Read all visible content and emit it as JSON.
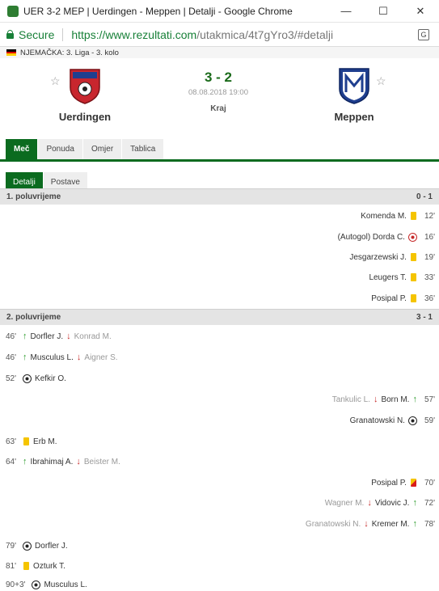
{
  "browser": {
    "tab_title": "UER 3-2 MEP | Uerdingen - Meppen | Detalji - Google Chrome",
    "secure_label": "Secure",
    "url_host": "https://www.rezultati.com",
    "url_path": "/utakmica/4t7gYro3/#detalji",
    "min_glyph": "—",
    "max_glyph": "☐",
    "close_glyph": "✕"
  },
  "league": "NJEMAČKA: 3. Liga - 3. kolo",
  "match": {
    "home": "Uerdingen",
    "away": "Meppen",
    "score": "3 - 2",
    "date": "08.08.2018 19:00",
    "status": "Kraj"
  },
  "tabs": [
    "Meč",
    "Ponuda",
    "Omjer",
    "Tablica"
  ],
  "subtabs": [
    "Detalji",
    "Postave"
  ],
  "halves": [
    {
      "label": "1. poluvrijeme",
      "score": "0 - 1"
    },
    {
      "label": "2. poluvrijeme",
      "score": "3 - 1"
    }
  ],
  "events_first": [
    {
      "side": "right",
      "minute": "12'",
      "type": "yellow",
      "player": "Komenda M."
    },
    {
      "side": "right",
      "minute": "16'",
      "type": "own-goal",
      "player": "(Autogol) Dorda C."
    },
    {
      "side": "right",
      "minute": "19'",
      "type": "yellow",
      "player": "Jesgarzewski J."
    },
    {
      "side": "right",
      "minute": "33'",
      "type": "yellow",
      "player": "Leugers T."
    },
    {
      "side": "right",
      "minute": "36'",
      "type": "yellow",
      "player": "Posipal P."
    }
  ],
  "events_second": [
    {
      "side": "left",
      "minute": "46'",
      "type": "sub",
      "player_in": "Dorfler J.",
      "player_out": "Konrad M."
    },
    {
      "side": "left",
      "minute": "46'",
      "type": "sub",
      "player_in": "Musculus L.",
      "player_out": "Aigner S."
    },
    {
      "side": "left",
      "minute": "52'",
      "type": "goal",
      "player": "Kefkir O."
    },
    {
      "side": "right",
      "minute": "57'",
      "type": "sub",
      "player_in": "Born M.",
      "player_out": "Tankulic L."
    },
    {
      "side": "right",
      "minute": "59'",
      "type": "goal",
      "player": "Granatowski N."
    },
    {
      "side": "left",
      "minute": "63'",
      "type": "yellow",
      "player": "Erb M."
    },
    {
      "side": "left",
      "minute": "64'",
      "type": "sub",
      "player_in": "Ibrahimaj A.",
      "player_out": "Beister M."
    },
    {
      "side": "right",
      "minute": "70'",
      "type": "yellow-red",
      "player": "Posipal P."
    },
    {
      "side": "right",
      "minute": "72'",
      "type": "sub",
      "player_in": "Vidovic J.",
      "player_out": "Wagner M."
    },
    {
      "side": "right",
      "minute": "78'",
      "type": "sub",
      "player_in": "Kremer M.",
      "player_out": "Granatowski N."
    },
    {
      "side": "left",
      "minute": "79'",
      "type": "goal",
      "player": "Dorfler J."
    },
    {
      "side": "left",
      "minute": "81'",
      "type": "yellow",
      "player": "Ozturk T."
    },
    {
      "side": "left",
      "minute": "90+3'",
      "type": "goal",
      "player": "Musculus L."
    }
  ],
  "colors": {
    "accent_green": "#0b6b1f",
    "score_green": "#1b6b1b",
    "yellow_card": "#f5c400",
    "sub_in": "#2e9d2e",
    "sub_out": "#c62828",
    "home_red": "#c8262e",
    "away_blue": "#1f3f8f"
  }
}
